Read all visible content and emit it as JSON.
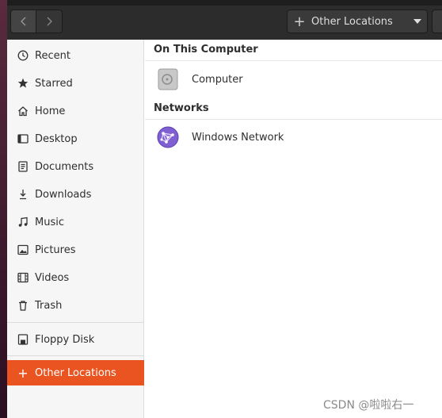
{
  "header": {
    "current_location": "Other Locations"
  },
  "sidebar": {
    "items": [
      {
        "label": "Recent",
        "icon": "clock-icon"
      },
      {
        "label": "Starred",
        "icon": "star-icon"
      },
      {
        "label": "Home",
        "icon": "home-icon"
      },
      {
        "label": "Desktop",
        "icon": "desktop-icon"
      },
      {
        "label": "Documents",
        "icon": "document-icon"
      },
      {
        "label": "Downloads",
        "icon": "download-icon"
      },
      {
        "label": "Music",
        "icon": "music-icon"
      },
      {
        "label": "Pictures",
        "icon": "picture-icon"
      },
      {
        "label": "Videos",
        "icon": "video-icon"
      },
      {
        "label": "Trash",
        "icon": "trash-icon"
      }
    ],
    "devices": [
      {
        "label": "Floppy Disk",
        "icon": "floppy-icon"
      }
    ],
    "other_locations": {
      "label": "Other Locations",
      "icon": "plus-icon"
    }
  },
  "main": {
    "sections": [
      {
        "title": "On This Computer",
        "items": [
          {
            "label": "Computer",
            "icon": "drive-icon"
          }
        ]
      },
      {
        "title": "Networks",
        "items": [
          {
            "label": "Windows Network",
            "icon": "network-icon"
          }
        ]
      }
    ]
  },
  "watermark": "CSDN @啦啦右一",
  "colors": {
    "accent": "#e95420",
    "headerbar": "#2c2c2c",
    "sidebar": "#f6f6f6"
  }
}
